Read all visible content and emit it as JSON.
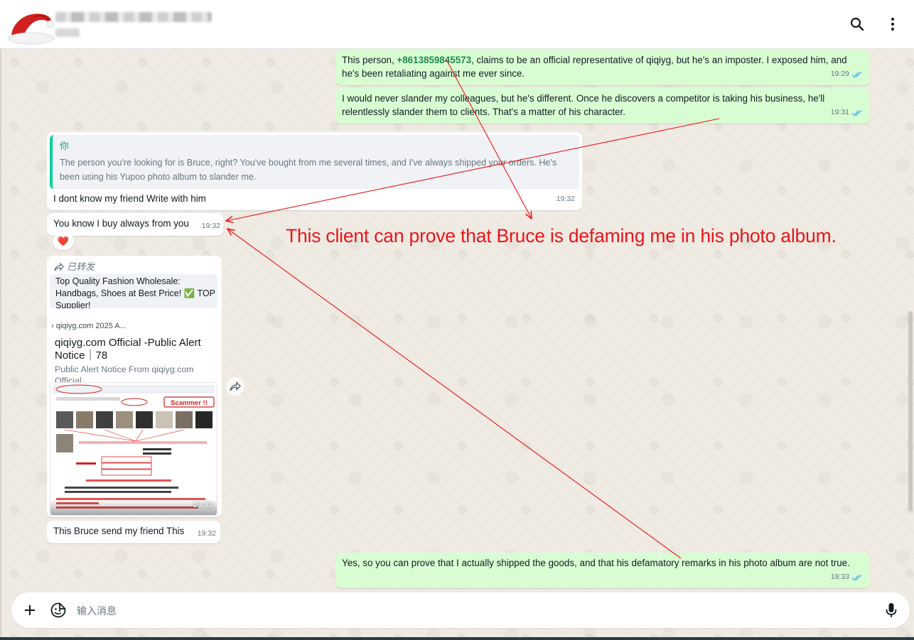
{
  "header": {
    "search_icon": "search-icon",
    "menu_icon": "more-vertical-icon"
  },
  "messages": {
    "m1": {
      "prefix": "This person, ",
      "phone": "+8613859845573",
      "suffix": ", claims to be an official representative of qiqiyg, but he's an imposter. I exposed him, and he's been retaliating against me ever since.",
      "time": "19:29"
    },
    "m2": {
      "text": "I would never slander my colleagues, but he's different. Once he discovers a competitor is taking his business, he'll relentlessly slander them to clients. That's a matter of his character.",
      "time": "19:31"
    },
    "m3": {
      "quote_author": "你",
      "quote_text": "The person you're looking for is Bruce, right? You've bought from me several times, and I've always shipped your orders. He's been using his Yupoo photo album to slander me.",
      "text": "I dont know my friend Write with him",
      "time": "19:32"
    },
    "m4": {
      "text": "You know I buy always from you",
      "time": "19:32",
      "reaction": "❤️"
    },
    "m5": {
      "forwarded_label": "已转发",
      "preview_text": "Top Quality Fashion Wholesale: Handbags, Shoes at Best Price! ✅ TOP Supplier!",
      "link_text": "qiqiyg.com 2025 A...",
      "title": "qiqiyg.com Official -Public Alert Notice｜78",
      "description": "Public Alert Notice From qiqiyg.com Official",
      "image_time": "19:32",
      "scammer_label": "Scammer !!"
    },
    "m6": {
      "text": "This Bruce send my friend This",
      "time": "19:32"
    },
    "m7": {
      "text": "Yes, so you can prove that I actually shipped the goods, and that his defamatory remarks in his photo album are not true.",
      "time": "19:33"
    }
  },
  "annotation": {
    "text": "This client can prove that Bruce is defaming me in his photo album.",
    "color": "#e8151b"
  },
  "composer": {
    "placeholder": "输入消息",
    "add_icon": "plus-icon",
    "sticker_icon": "sticker-icon",
    "mic_icon": "microphone-icon"
  },
  "colors": {
    "outgoing_bubble": "#d9fdd3",
    "incoming_bubble": "#ffffff",
    "read_ticks": "#53bdeb",
    "phone_link": "#1c8a4c",
    "quote_accent": "#06cf9c"
  }
}
